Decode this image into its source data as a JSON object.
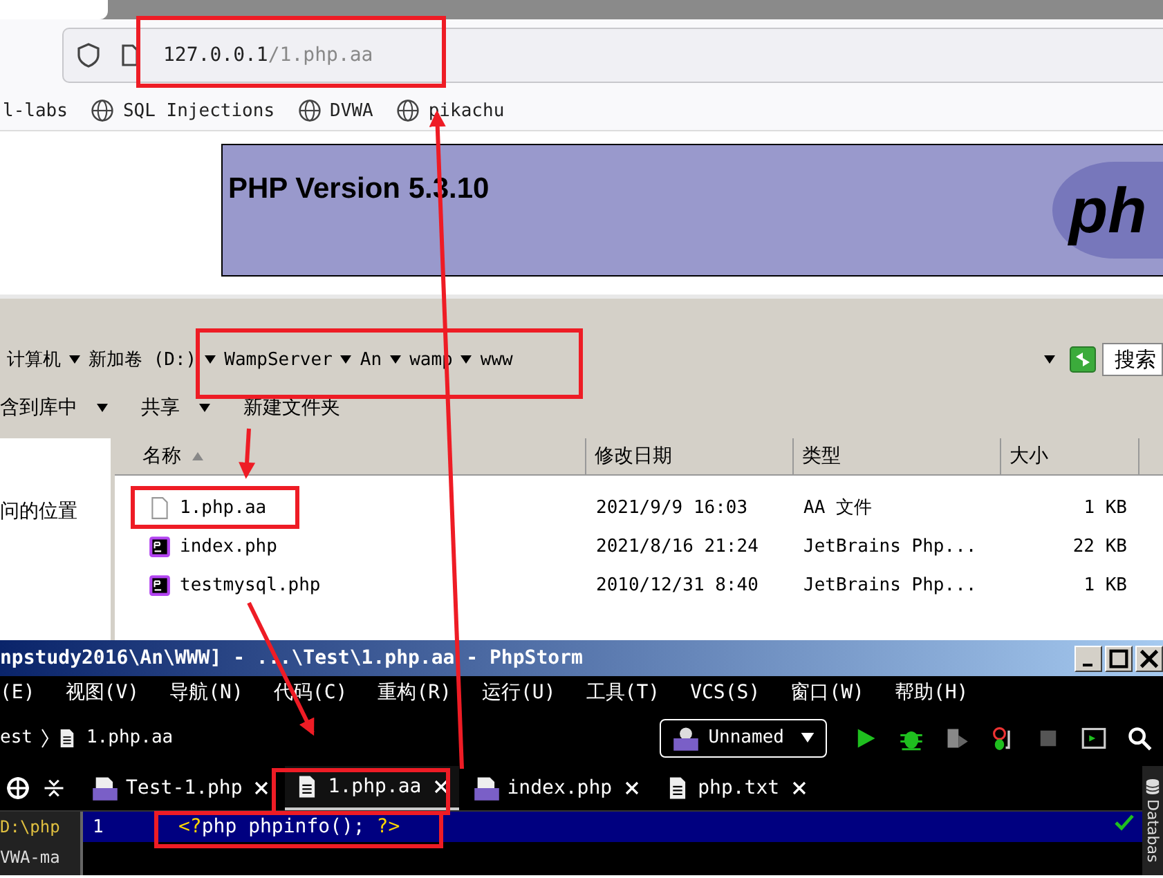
{
  "browser": {
    "url_host": "127.0.0.1",
    "url_path": "/1.php.aa",
    "bookmarks": [
      "l-labs",
      "SQL Injections",
      "DVWA",
      "pikachu"
    ],
    "page": {
      "title": "PHP Version 5.3.10",
      "logo_text": "ph"
    }
  },
  "explorer": {
    "breadcrumb": [
      "计算机",
      "新加卷 (D:)",
      "WampServer",
      "An",
      "wamp",
      "www"
    ],
    "search_placeholder": "搜索",
    "toolbar": [
      {
        "label": "含到库中",
        "dropdown": true
      },
      {
        "label": "共享",
        "dropdown": true
      },
      {
        "label": "新建文件夹",
        "dropdown": false
      }
    ],
    "nav_item": "问的位置",
    "columns": [
      {
        "label": "名称",
        "sorted": true
      },
      {
        "label": "修改日期",
        "sorted": false
      },
      {
        "label": "类型",
        "sorted": false
      },
      {
        "label": "大小",
        "sorted": false
      }
    ],
    "files": [
      {
        "name": "1.php.aa",
        "kind": "blank",
        "modified": "2021/9/9 16:03",
        "type": "AA 文件",
        "size": "1 KB"
      },
      {
        "name": "index.php",
        "kind": "phpstorm",
        "modified": "2021/8/16 21:24",
        "type": "JetBrains Php...",
        "size": "22 KB"
      },
      {
        "name": "testmysql.php",
        "kind": "phpstorm",
        "modified": "2010/12/31 8:40",
        "type": "JetBrains Php...",
        "size": "1 KB"
      }
    ]
  },
  "ide": {
    "title": "npstudy2016\\An\\WWW] - ...\\Test\\1.php.aa - PhpStorm",
    "menu": [
      "(E)",
      "视图(V)",
      "导航(N)",
      "代码(C)",
      "重构(R)",
      "运行(U)",
      "工具(T)",
      "VCS(S)",
      "窗口(W)",
      "帮助(H)"
    ],
    "breadcrumb": [
      "est",
      "1.php.aa"
    ],
    "run_config": "Unnamed",
    "tabs": [
      {
        "label": "Test-1.php",
        "kind": "php",
        "selected": false
      },
      {
        "label": "1.php.aa",
        "kind": "text",
        "selected": true
      },
      {
        "label": "index.php",
        "kind": "php",
        "selected": false
      },
      {
        "label": "php.txt",
        "kind": "text",
        "selected": false
      }
    ],
    "project_lines": [
      "D:\\php",
      "VWA-ma"
    ],
    "code_lines": [
      {
        "number": "1",
        "tokens": [
          {
            "text": "<?",
            "kind": "tag"
          },
          {
            "text": "php phpinfo(); ",
            "kind": "code"
          },
          {
            "text": "?>",
            "kind": "tag"
          }
        ]
      }
    ],
    "side_tool": "Databas"
  }
}
